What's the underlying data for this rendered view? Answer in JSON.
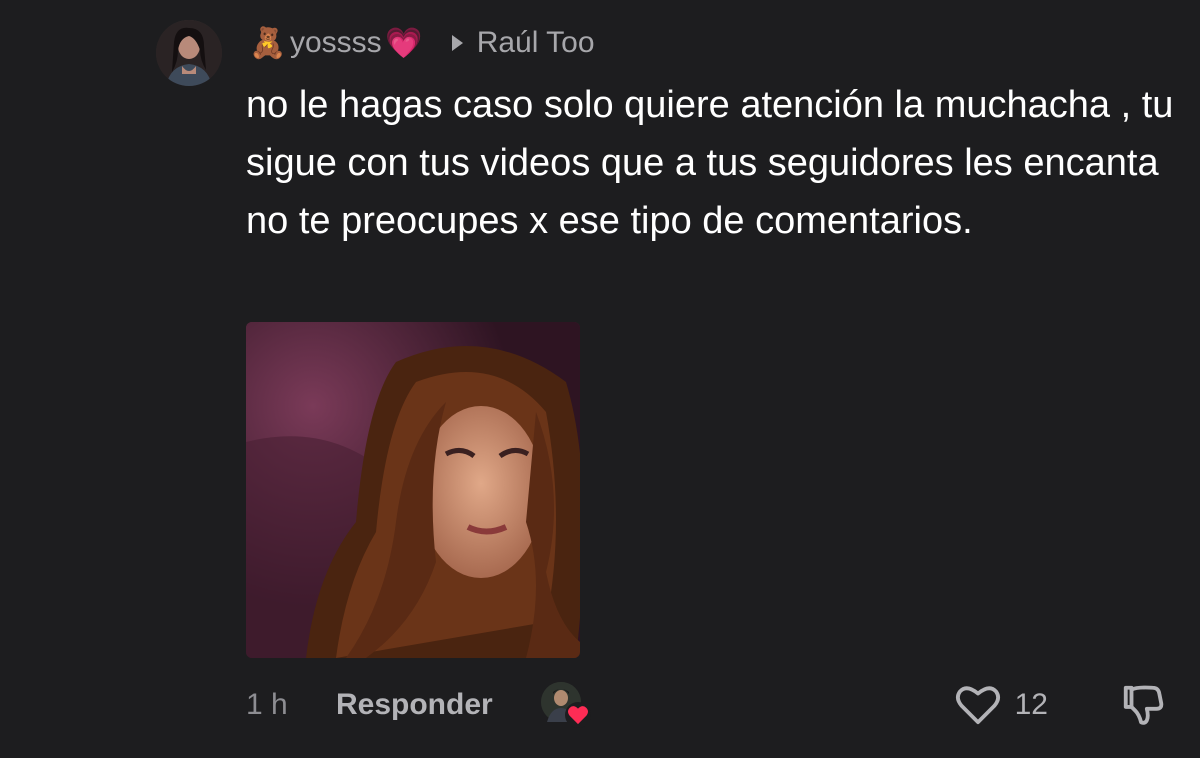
{
  "comment": {
    "author": {
      "name": "yossss",
      "prefix_emoji": "🧸",
      "suffix_emoji": "💗"
    },
    "reply_to": "Raúl Too",
    "text": "no le hagas caso solo quiere atención la muchacha , tu sigue con tus videos que a tus seguidores les encanta no te preocupes x ese tipo de comentarios.",
    "attachment": {
      "type": "gif"
    },
    "footer": {
      "time": "1 h",
      "reply_label": "Responder",
      "like_count": "12"
    }
  },
  "colors": {
    "background": "#1d1d1f",
    "muted_text": "#a7a7ab",
    "like_badge": "#fe2c55"
  },
  "icons": {
    "reply_indicator": "triangle-right-icon",
    "like": "heart-outline-icon",
    "dislike": "thumbs-down-icon",
    "creator_liked": "heart-filled-icon"
  }
}
